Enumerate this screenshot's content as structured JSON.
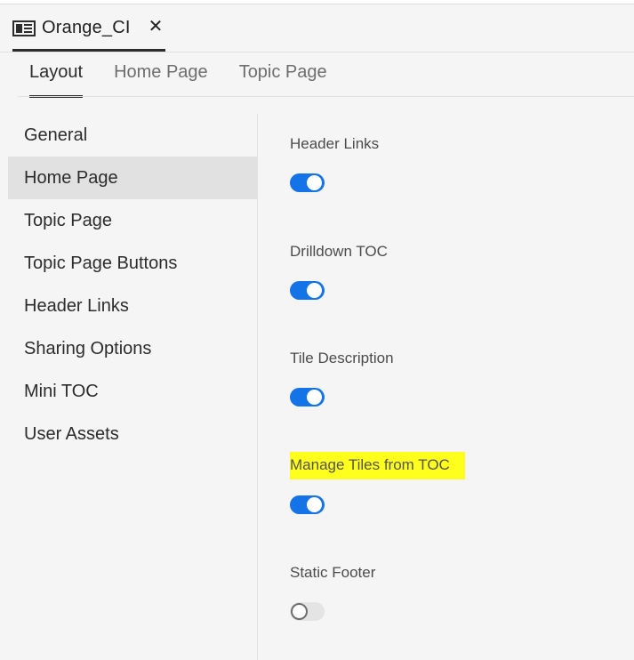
{
  "document_tab": {
    "icon": "document-icon",
    "title": "Orange_CI",
    "close_glyph": "✕"
  },
  "inner_tabs": [
    {
      "label": "Layout",
      "active": true
    },
    {
      "label": "Home Page",
      "active": false
    },
    {
      "label": "Topic Page",
      "active": false
    }
  ],
  "left_nav": {
    "items": [
      {
        "label": "General",
        "selected": false
      },
      {
        "label": "Home Page",
        "selected": true
      },
      {
        "label": "Topic Page",
        "selected": false
      },
      {
        "label": "Topic Page Buttons",
        "selected": false
      },
      {
        "label": "Header Links",
        "selected": false
      },
      {
        "label": "Sharing Options",
        "selected": false
      },
      {
        "label": "Mini TOC",
        "selected": false
      },
      {
        "label": "User Assets",
        "selected": false
      }
    ]
  },
  "settings": [
    {
      "label": "Header Links",
      "enabled": true,
      "highlighted": false
    },
    {
      "label": "Drilldown TOC",
      "enabled": true,
      "highlighted": false
    },
    {
      "label": "Tile Description",
      "enabled": true,
      "highlighted": false
    },
    {
      "label": "Manage Tiles from TOC",
      "enabled": true,
      "highlighted": true
    },
    {
      "label": "Static Footer",
      "enabled": false,
      "highlighted": false
    }
  ],
  "colors": {
    "toggle_on": "#1473e6",
    "highlight": "#ffff1e",
    "selected_nav": "#e1e1e1"
  }
}
